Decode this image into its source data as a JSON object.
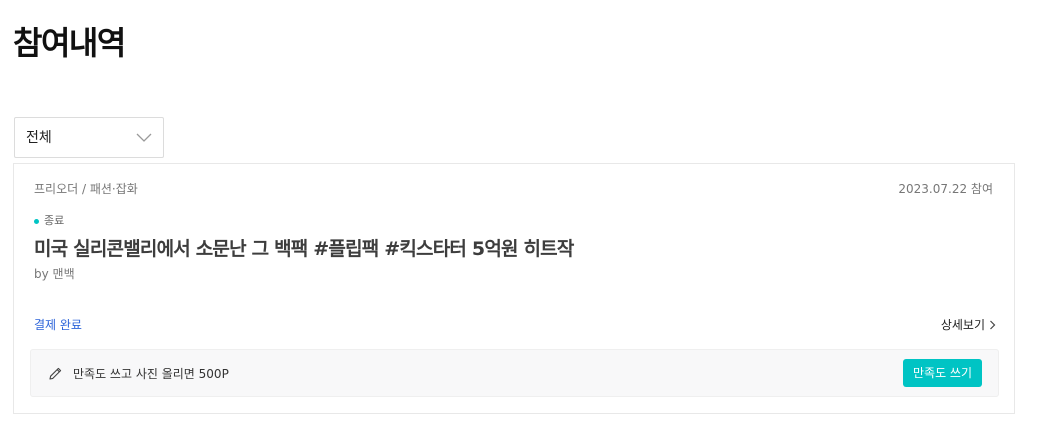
{
  "page": {
    "title": "참여내역"
  },
  "filter": {
    "selected": "전체",
    "icon": "chevron-down-icon"
  },
  "card": {
    "category": "프리오더 / 패션·잡화",
    "date": "2023.07.22 참여",
    "status": "종료",
    "status_color": "#00c4c4",
    "title": "미국 실리콘밸리에서 소문난 그 백팩 #플립팩 #킥스타터 5억원 히트작",
    "maker": "by 맨백",
    "payment_status": "결제 완료",
    "detail_label": "상세보기",
    "review": {
      "icon": "pencil-icon",
      "text": "만족도 쓰고 사진 올리면 500P",
      "button_label": "만족도 쓰기",
      "button_color": "#00c4c4"
    }
  }
}
